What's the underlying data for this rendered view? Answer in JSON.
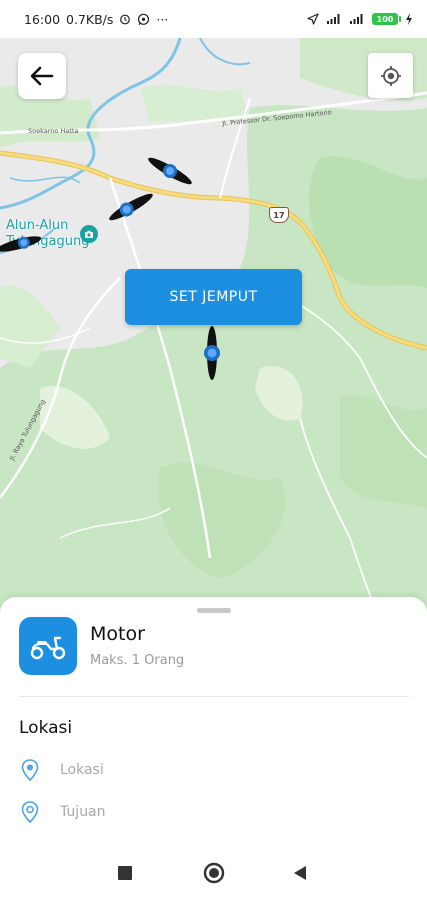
{
  "status_bar": {
    "time": "16:00",
    "network_speed": "0.7KB/s",
    "battery_level": "100"
  },
  "map": {
    "labels": {
      "road_top_left": "Soekarno Hatta",
      "road_top_right": "Jl. Professor Dr. Soepomo Hartono",
      "road_bottom_left": "Jl. Raya Tulungagung",
      "road_number": "17",
      "poi_line1": "Alun-Alun",
      "poi_line2": "Tulungagung"
    },
    "set_pickup_label": "SET JEMPUT"
  },
  "sheet": {
    "vehicle": {
      "name": "Motor",
      "capacity": "Maks. 1 Orang"
    },
    "section_title": "Lokasi",
    "pickup_placeholder": "Lokasi",
    "destination_placeholder": "Tujuan"
  },
  "colors": {
    "accent": "#1d8fe0",
    "map_green": "#c8e6c3",
    "map_gray": "#eaeaea",
    "road_yellow": "#f3d46a",
    "water": "#7fc3e8"
  },
  "icons": {
    "back": "back-arrow-icon",
    "locate": "my-location-icon",
    "vehicle": "scooter-icon",
    "pickup": "pickup-pin-icon",
    "destination": "destination-pin-icon",
    "nav_recent": "square-icon",
    "nav_home": "circle-icon",
    "nav_back": "triangle-back-icon"
  }
}
